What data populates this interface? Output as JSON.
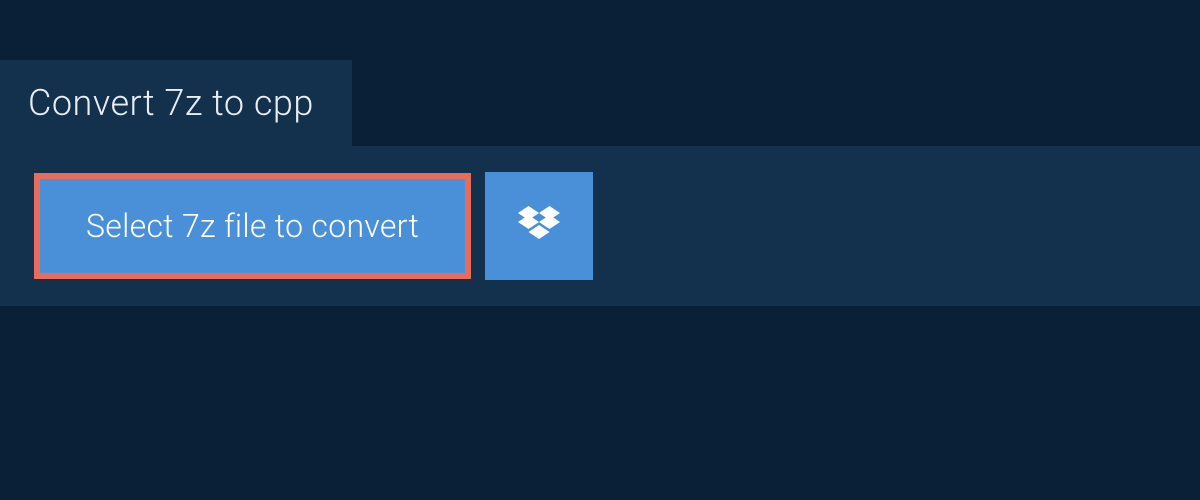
{
  "header": {
    "title": "Convert 7z to cpp"
  },
  "actions": {
    "select_file_label": "Select 7z file to convert"
  },
  "colors": {
    "background_dark": "#0a2036",
    "panel": "#13304d",
    "button_primary": "#4a90d9",
    "highlight_border": "#e86b5c",
    "text_light": "#e8eef4",
    "text_white": "#ffffff"
  }
}
